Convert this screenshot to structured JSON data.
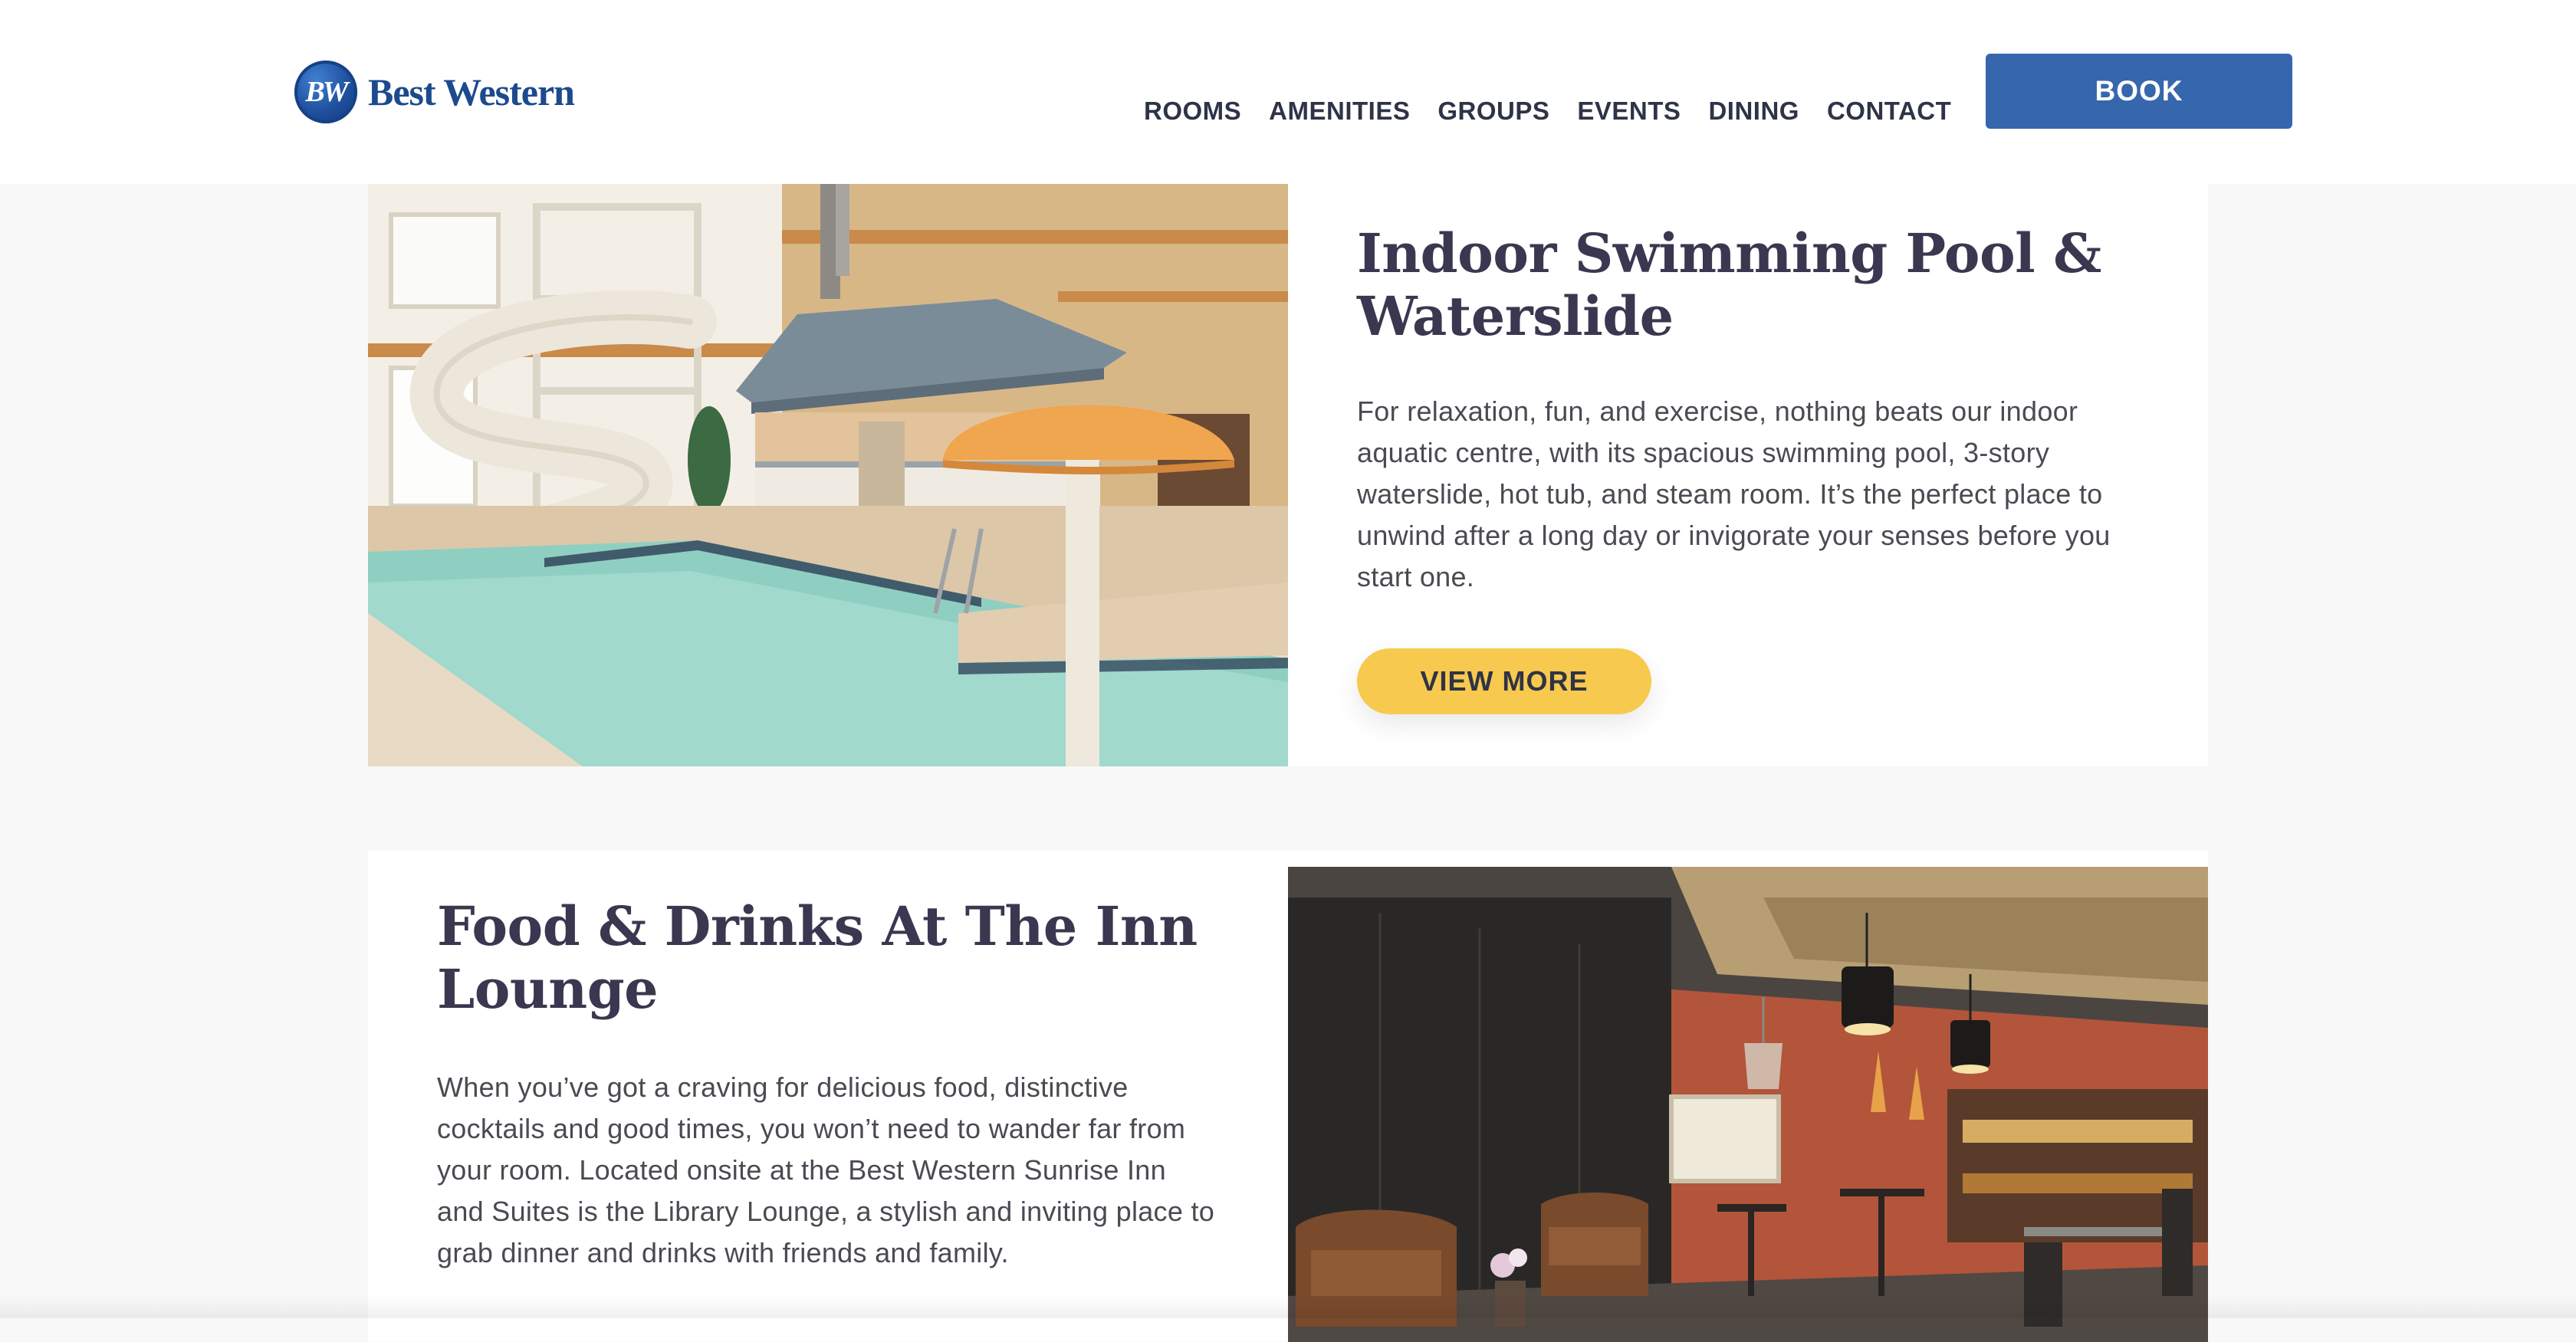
{
  "brand": {
    "logo_badge": "BW",
    "logo_text": "Best Western",
    "primary_color": "#3667ad",
    "accent_color": "#f7c94e"
  },
  "nav": {
    "items": [
      {
        "label": "ROOMS"
      },
      {
        "label": "AMENITIES"
      },
      {
        "label": "GROUPS"
      },
      {
        "label": "EVENTS"
      },
      {
        "label": "DINING"
      },
      {
        "label": "CONTACT"
      }
    ],
    "book_label": "BOOK"
  },
  "sections": [
    {
      "title": "Indoor Swimming Pool & Waterslide",
      "description": "For relaxation, fun, and exercise, nothing beats our indoor aquatic centre, with its spacious swimming pool, 3-story waterslide, hot tub, and steam room. It’s the perfect place to unwind after a long day or invigorate your senses before you start one.",
      "button_label": "VIEW MORE"
    },
    {
      "title": "Food & Drinks At The Inn Lounge",
      "description": "When you’ve got a craving for delicious food, distinctive cocktails and good times, you won’t need to wander far from your room. Located onsite at the Best Western Sunrise Inn and Suites is the Library Lounge, a stylish and inviting place to grab dinner and drinks with friends and family."
    }
  ]
}
